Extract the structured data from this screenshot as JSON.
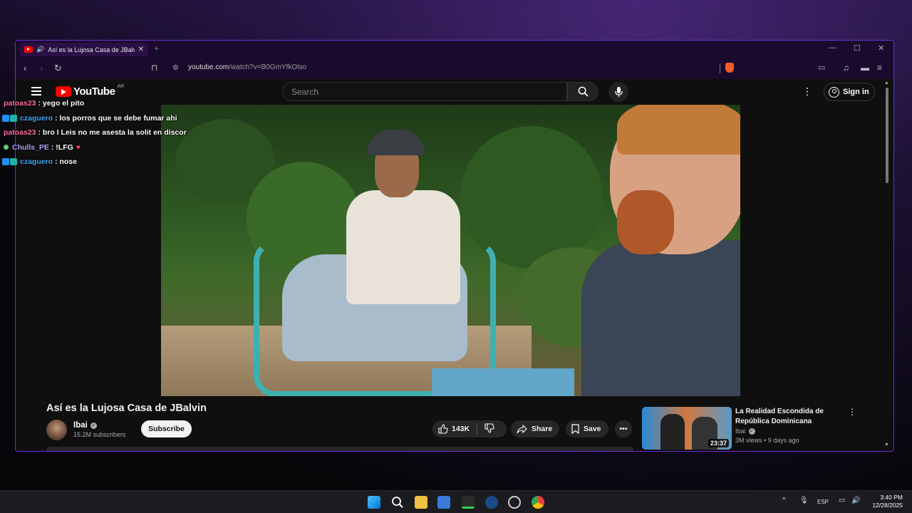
{
  "browser": {
    "tab_title": "Así es la Lujosa Casa de JBalvin",
    "url_domain": "youtube.com",
    "url_path": "/watch?v=B0GmYfkOlso"
  },
  "youtube": {
    "logo_text": "YouTube",
    "country_code": "AR",
    "search_placeholder": "Search",
    "sign_in_label": "Sign in"
  },
  "chat": [
    {
      "user": "patoas23",
      "message": "yego el pito",
      "badge": "none"
    },
    {
      "user": "czaguero",
      "message": "los porros que se debe fumar ahi",
      "badge": "blue"
    },
    {
      "user": "patoas23",
      "message": "bro I Leis no me asesta la solit en discor",
      "badge": "none"
    },
    {
      "user": "Chulls_PE",
      "message": "!LFG",
      "badge": "dot"
    },
    {
      "user": "czaguero",
      "message": "nose",
      "badge": "blue"
    }
  ],
  "video": {
    "title": "Así es la Lujosa Casa de JBalvin",
    "channel": "Ibai",
    "subscribers": "15.2M subscribers",
    "subscribe_label": "Subscribe",
    "likes": "143K",
    "share_label": "Share",
    "save_label": "Save"
  },
  "recommendation": {
    "title": "La Realidad Escondida de República Dominicana",
    "channel": "Ibai",
    "meta": "3M views • 9 days ago",
    "duration": "23:37"
  },
  "taskbar": {
    "language": "ESP",
    "time": "3:40 PM",
    "date": "12/28/2025"
  },
  "colors": {
    "accent_purple": "#6a2fd0",
    "youtube_red": "#ff0000"
  }
}
